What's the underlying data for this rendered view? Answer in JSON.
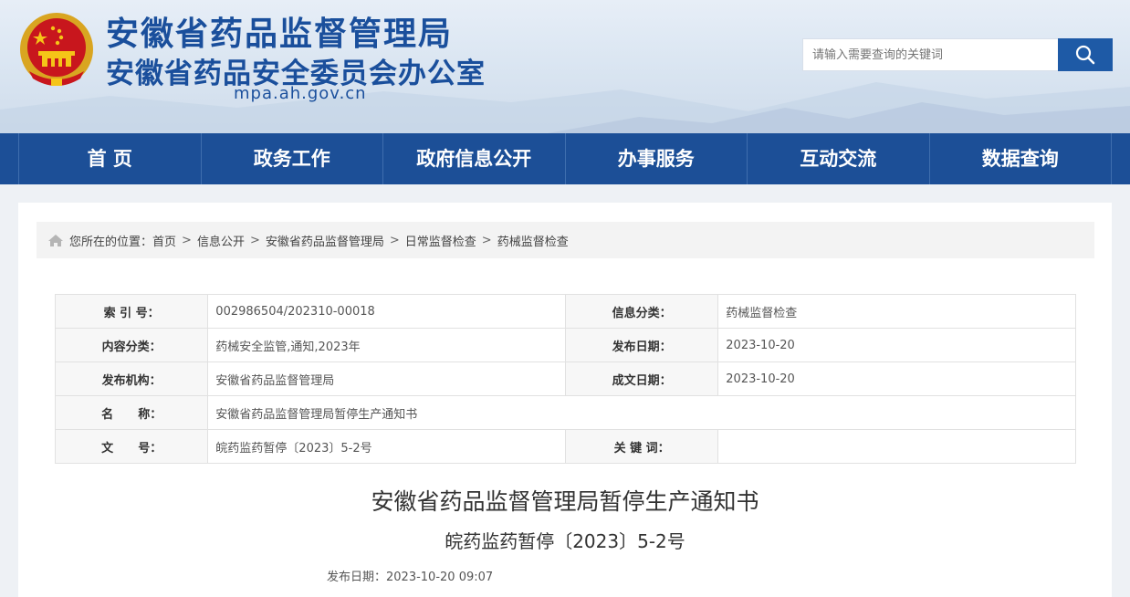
{
  "header": {
    "title_main": "安徽省药品监督管理局",
    "title_sub": "安徽省药品安全委员会办公室",
    "domain": "mpa.ah.gov.cn",
    "search_placeholder": "请输入需要查询的关键词",
    "accent": "#1c4f97"
  },
  "nav": {
    "items": [
      "首 页",
      "政务工作",
      "政府信息公开",
      "办事服务",
      "互动交流",
      "数据查询"
    ]
  },
  "breadcrumb": {
    "prefix": "您所在的位置：",
    "items": [
      "首页",
      "信息公开",
      "安徽省药品监督管理局",
      "日常监督检查",
      "药械监督检查"
    ],
    "separator": ">"
  },
  "meta": {
    "rows": [
      {
        "l1": "索 引 号：",
        "v1": "002986504/202310-00018",
        "l2": "信息分类：",
        "v2": "药械监督检查"
      },
      {
        "l1": "内容分类：",
        "v1": "药械安全监管,通知,2023年",
        "l2": "发布日期：",
        "v2": "2023-10-20"
      },
      {
        "l1": "发布机构：",
        "v1": "安徽省药品监督管理局",
        "l2": "成文日期：",
        "v2": "2023-10-20"
      },
      {
        "l1": "名      称：",
        "v1": "安徽省药品监督管理局暂停生产通知书"
      },
      {
        "l1": "文      号：",
        "v1": "皖药监药暂停〔2023〕5-2号",
        "l2": "关 键 词：",
        "v2": ""
      }
    ]
  },
  "article": {
    "title": "安徽省药品监督管理局暂停生产通知书",
    "doc_number": "皖药监药暂停〔2023〕5-2号",
    "publish_label": "发布日期：",
    "publish_time": "2023-10-20 09:07"
  }
}
